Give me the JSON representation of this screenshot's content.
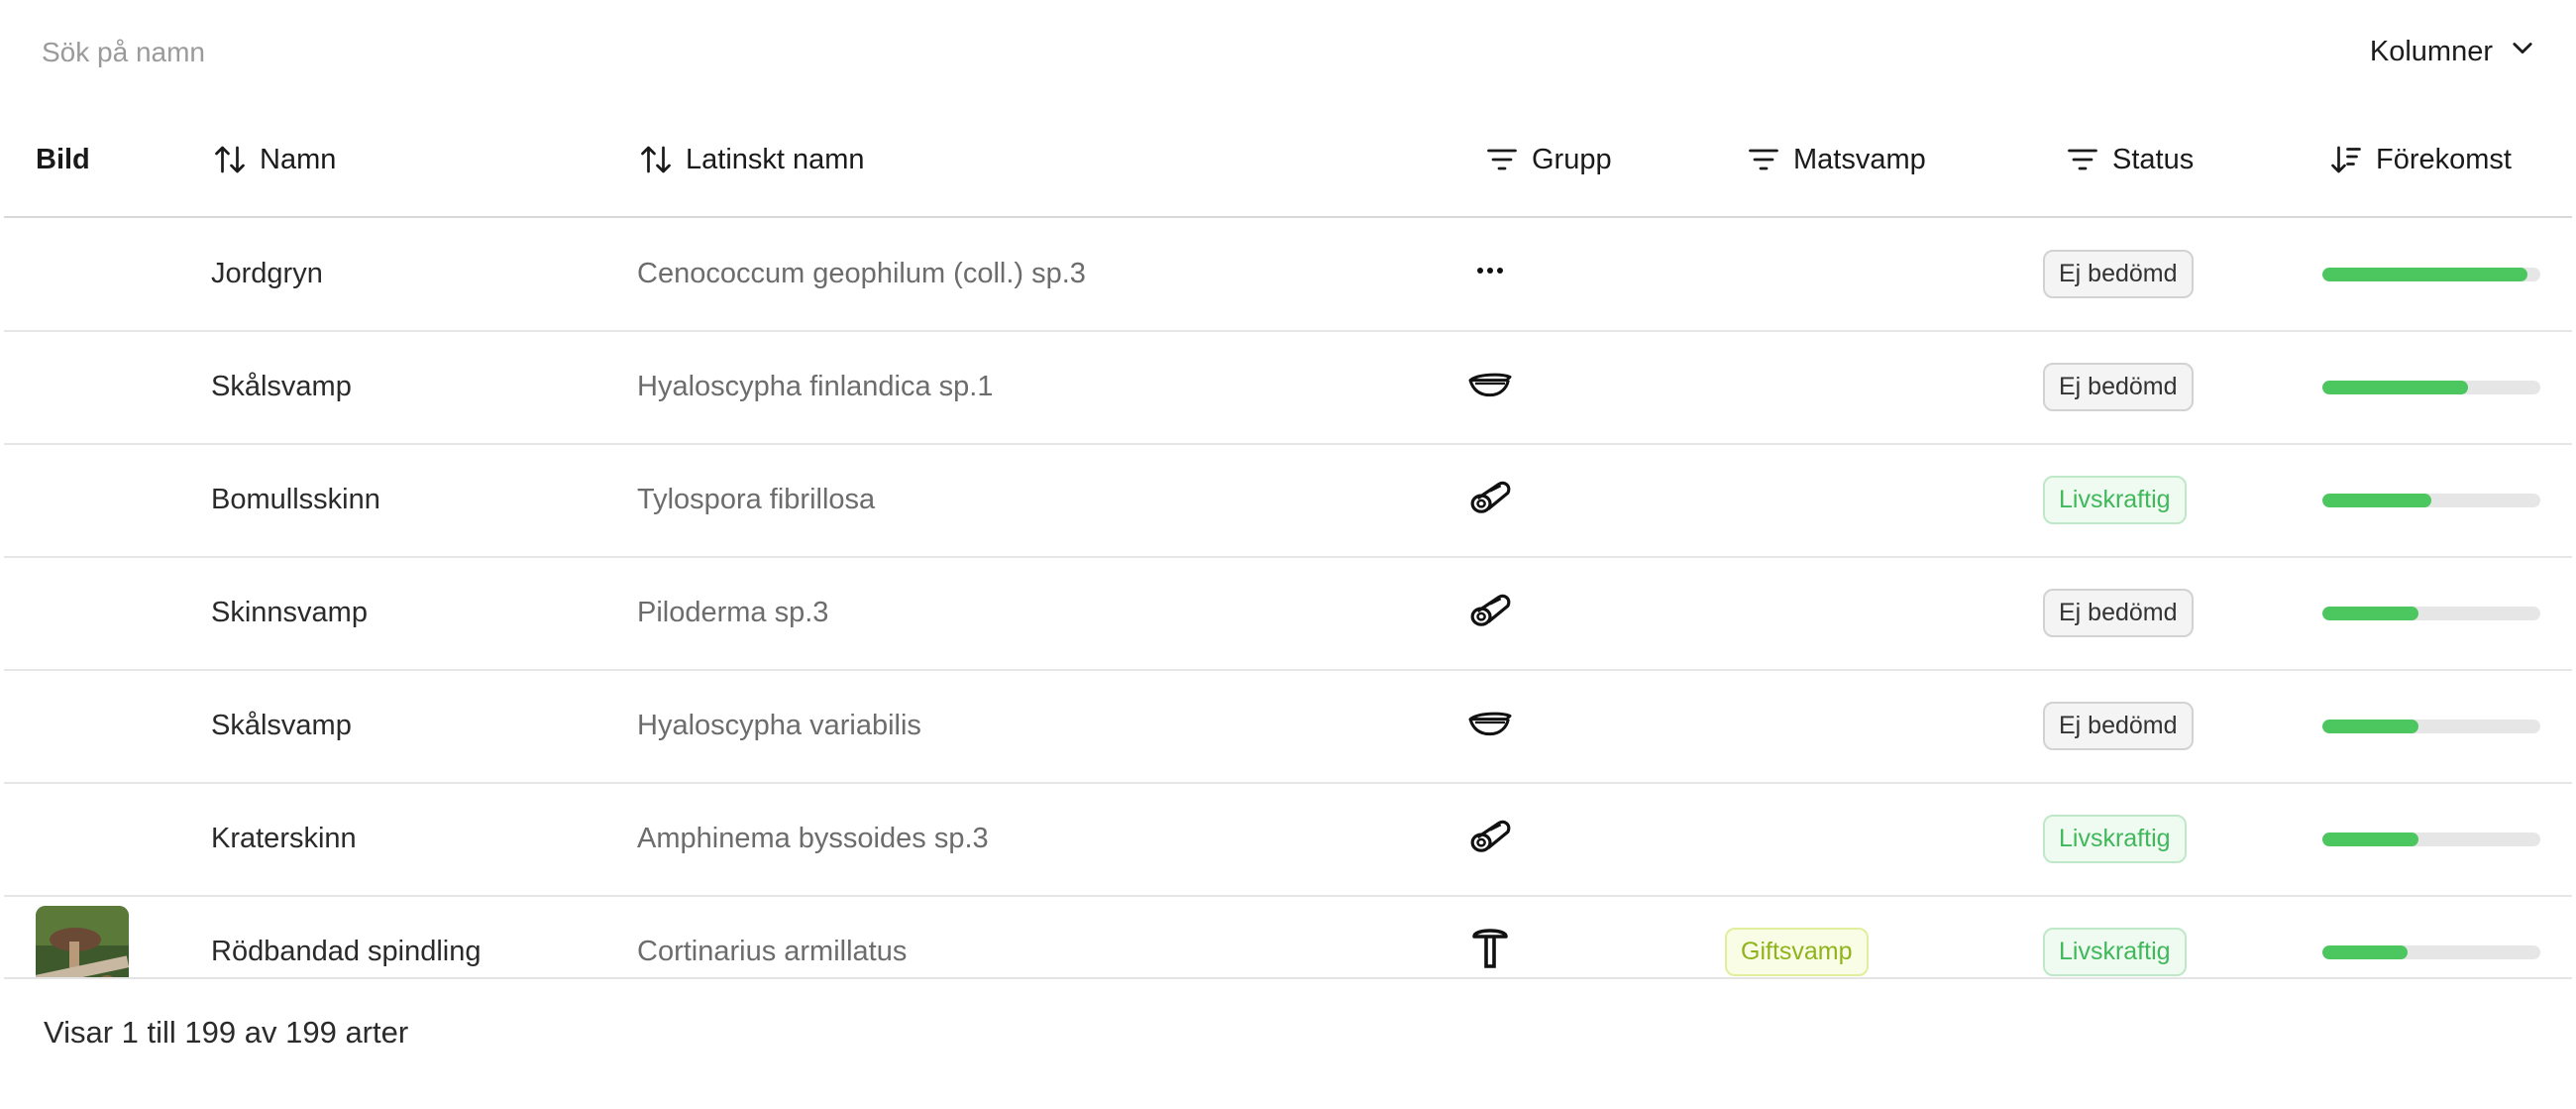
{
  "toolbar": {
    "search_placeholder": "Sök på namn",
    "columns_label": "Kolumner"
  },
  "table": {
    "columns": {
      "image": "Bild",
      "name": "Namn",
      "latin": "Latinskt namn",
      "group": "Grupp",
      "edible": "Matsvamp",
      "status": "Status",
      "occurrence": "Förekomst"
    },
    "rows": [
      {
        "name": "Jordgryn",
        "latin": "Cenococcum geophilum (coll.) sp.3",
        "group_icon": "more-dots-icon",
        "edible": "",
        "status": "Ej bedömd",
        "status_kind": "neutral",
        "occurrence": 0.94,
        "has_image": false
      },
      {
        "name": "Skålsvamp",
        "latin": "Hyaloscypha finlandica sp.1",
        "group_icon": "cup-fungus-icon",
        "edible": "",
        "status": "Ej bedömd",
        "status_kind": "neutral",
        "occurrence": 0.67,
        "has_image": false
      },
      {
        "name": "Bomullsskinn",
        "latin": "Tylospora fibrillosa",
        "group_icon": "log-crust-icon",
        "edible": "",
        "status": "Livskraftig",
        "status_kind": "vital",
        "occurrence": 0.5,
        "has_image": false
      },
      {
        "name": "Skinnsvamp",
        "latin": "Piloderma sp.3",
        "group_icon": "log-crust-icon",
        "edible": "",
        "status": "Ej bedömd",
        "status_kind": "neutral",
        "occurrence": 0.44,
        "has_image": false
      },
      {
        "name": "Skålsvamp",
        "latin": "Hyaloscypha variabilis",
        "group_icon": "cup-fungus-icon",
        "edible": "",
        "status": "Ej bedömd",
        "status_kind": "neutral",
        "occurrence": 0.44,
        "has_image": false
      },
      {
        "name": "Kraterskinn",
        "latin": "Amphinema byssoides sp.3",
        "group_icon": "log-crust-icon",
        "edible": "",
        "status": "Livskraftig",
        "status_kind": "vital",
        "occurrence": 0.44,
        "has_image": false
      },
      {
        "name": "Rödbandad spindling",
        "latin": "Cortinarius armillatus",
        "group_icon": "cap-mushroom-icon",
        "edible": "Giftsvamp",
        "status": "Livskraftig",
        "status_kind": "vital",
        "occurrence": 0.39,
        "has_image": true
      }
    ]
  },
  "footer": {
    "summary": "Visar 1 till 199 av 199 arter"
  },
  "colors": {
    "bar_fill": "#4cc760",
    "bar_track": "#e6e6e6",
    "vital_text": "#3fb85a",
    "poison_text": "#8fb31a"
  }
}
